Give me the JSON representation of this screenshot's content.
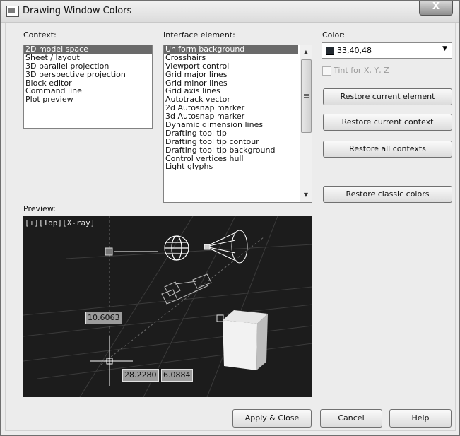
{
  "window": {
    "title": "Drawing Window Colors",
    "close_glyph": "X"
  },
  "context": {
    "label": "Context:",
    "items": [
      "2D model space",
      "Sheet / layout",
      "3D parallel projection",
      "3D perspective projection",
      "Block editor",
      "Command line",
      "Plot preview"
    ],
    "selected_index": 0
  },
  "interface": {
    "label": "Interface element:",
    "items": [
      "Uniform background",
      "Crosshairs",
      "Viewport control",
      "Grid major lines",
      "Grid minor lines",
      "Grid axis lines",
      "Autotrack vector",
      "2d Autosnap marker",
      "3d Autosnap marker",
      "Dynamic dimension lines",
      "Drafting tool tip",
      "Drafting tool tip contour",
      "Drafting tool tip background",
      "Control vertices hull",
      "Light glyphs"
    ],
    "selected_index": 0
  },
  "color": {
    "label": "Color:",
    "value": "33,40,48",
    "swatch_hex": "#21282f",
    "tint_label": "Tint for X, Y, Z"
  },
  "buttons": {
    "restore_element": "Restore current element",
    "restore_context": "Restore current context",
    "restore_all": "Restore all contexts",
    "restore_classic": "Restore classic colors",
    "apply_close": "Apply & Close",
    "cancel": "Cancel",
    "help": "Help"
  },
  "preview": {
    "label": "Preview:",
    "viewport_label": "[+][Top][X-ray]",
    "dim_vertical": "10.6063",
    "dim_x": "28.2280",
    "dim_y": "6.0884"
  },
  "icons": [
    "app-icon",
    "close-icon",
    "scroll-up-icon",
    "scroll-down-icon",
    "dropdown-arrow-icon",
    "grip-icon"
  ]
}
